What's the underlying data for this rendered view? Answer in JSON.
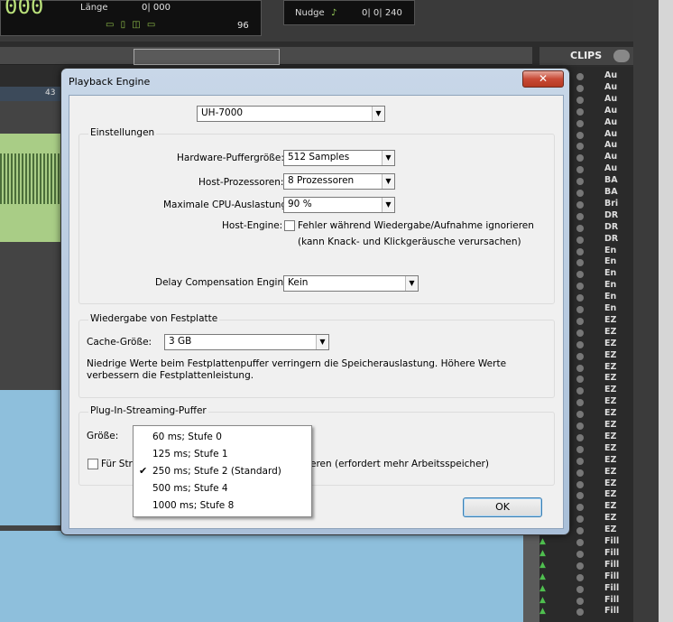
{
  "daw": {
    "counter_main": "000",
    "laenge_label": "Länge",
    "laenge_value": "0| 000",
    "grid_value": "96",
    "nudge_label": "Nudge",
    "nudge_value": "0| 0| 240",
    "ruler_marker": "43",
    "clips_title": "CLIPS",
    "clips": [
      "Au",
      "Au",
      "Au",
      "Au",
      "Au",
      "Au",
      "Au",
      "Au",
      "Au",
      "BA",
      "BA",
      "Bri",
      "DR",
      "DR",
      "DR",
      "En",
      "En",
      "En",
      "En",
      "En",
      "En",
      "EZ",
      "EZ",
      "EZ",
      "EZ",
      "EZ",
      "EZ",
      "EZ",
      "EZ",
      "EZ",
      "EZ",
      "EZ",
      "EZ",
      "EZ",
      "EZ",
      "EZ",
      "EZ",
      "EZ",
      "EZ",
      "EZ",
      "Fill",
      "Fill",
      "Fill",
      "Fill",
      "Fill",
      "Fill",
      "Fill"
    ]
  },
  "dialog": {
    "title": "Playback Engine",
    "close_label": "✕",
    "device": "UH-7000",
    "einstellungen": {
      "title": "Einstellungen",
      "buffer_label": "Hardware-Puffergröße:",
      "buffer_value": "512 Samples",
      "host_proc_label": "Host-Prozessoren:",
      "host_proc_value": "8 Prozessoren",
      "cpu_label": "Maximale CPU-Auslastung:",
      "cpu_value": "90 %",
      "host_engine_label": "Host-Engine:",
      "host_engine_option": "Fehler während Wiedergabe/Aufnahme ignorieren",
      "host_engine_note": "(kann Knack- und Klickgeräusche verursachen)",
      "delay_label": "Delay Compensation Engine:",
      "delay_value": "Kein"
    },
    "festplatte": {
      "title": "Wiedergabe von Festplatte",
      "cache_label": "Cache-Größe:",
      "cache_value": "3 GB",
      "note_line1": "Niedrige Werte beim Festplattenpuffer verringern die Speicherauslastung.  Höhere Werte",
      "note_line2": "verbessern die Festplattenleistung."
    },
    "streaming": {
      "title": "Plug-In-Streaming-Puffer",
      "groesse_label": "Größe:",
      "checkbox_label_start": "Für Stre",
      "checkbox_label_end": "eren (erfordert mehr Arbeitsspeicher)"
    },
    "ok_label": "OK",
    "popup": {
      "options": [
        "60 ms; Stufe 0",
        "125 ms; Stufe 1",
        "250 ms; Stufe 2 (Standard)",
        "500 ms; Stufe 4",
        "1000 ms; Stufe 8"
      ],
      "selected_index": 2,
      "check_mark": "✔"
    }
  }
}
